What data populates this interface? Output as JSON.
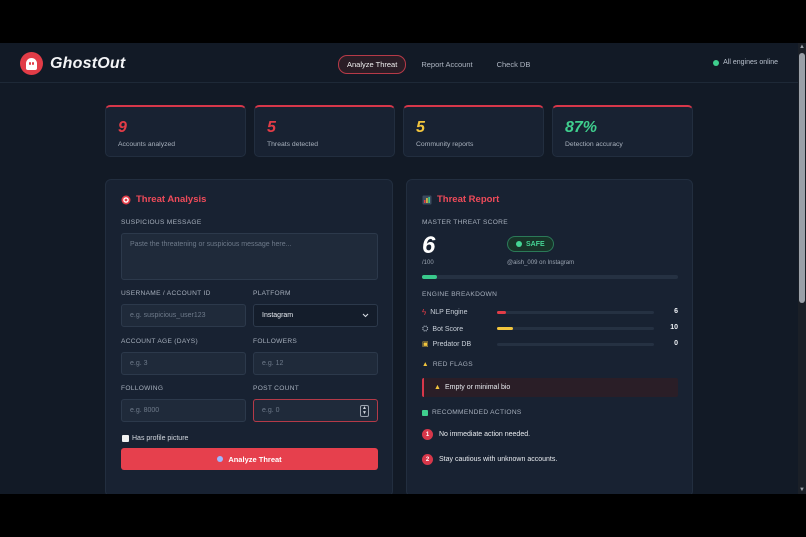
{
  "header": {
    "brand": "GhostOut",
    "nav": [
      "Analyze Threat",
      "Report Account",
      "Check DB"
    ],
    "status": "All engines online"
  },
  "stats": [
    {
      "value": "9",
      "label": "Accounts analyzed",
      "color": "#e23c47"
    },
    {
      "value": "5",
      "label": "Threats detected",
      "color": "#e23c47"
    },
    {
      "value": "5",
      "label": "Community reports",
      "color": "#f2c53d"
    },
    {
      "value": "87%",
      "label": "Detection accuracy",
      "color": "#3fcf8e"
    }
  ],
  "analysis": {
    "title": "Threat Analysis",
    "message_label": "SUSPICIOUS MESSAGE",
    "message_placeholder": "Paste the threatening or suspicious message here...",
    "username_label": "USERNAME / ACCOUNT ID",
    "username_placeholder": "e.g. suspicious_user123",
    "platform_label": "PLATFORM",
    "platform_value": "Instagram",
    "age_label": "ACCOUNT AGE (DAYS)",
    "age_placeholder": "e.g. 3",
    "followers_label": "FOLLOWERS",
    "followers_placeholder": "e.g. 12",
    "following_label": "FOLLOWING",
    "following_placeholder": "e.g. 8000",
    "posts_label": "POST COUNT",
    "posts_placeholder": "e.g. 0",
    "profile_pic_label": "Has profile picture",
    "analyze_button": "Analyze Threat"
  },
  "report": {
    "title": "Threat Report",
    "score_label": "MASTER THREAT SCORE",
    "score": "6",
    "score_of": "/100",
    "score_fraction": 0.06,
    "badge": "SAFE",
    "handle": "@aish_009 on Instagram",
    "engine_label": "ENGINE BREAKDOWN",
    "engines": [
      {
        "name": "NLP Engine",
        "value": "6",
        "level": 0.06,
        "color": "#e23c47"
      },
      {
        "name": "Bot Score",
        "value": "10",
        "level": 0.1,
        "color": "#f2c53d"
      },
      {
        "name": "Predator DB",
        "value": "0",
        "level": 0,
        "color": "#3fcf8e"
      }
    ],
    "flags_label": "RED FLAGS",
    "flag": "Empty or minimal bio",
    "actions_label": "RECOMMENDED ACTIONS",
    "actions": [
      {
        "num": "1",
        "text": "No immediate action needed."
      },
      {
        "num": "2",
        "text": "Stay cautious with unknown accounts."
      }
    ]
  }
}
